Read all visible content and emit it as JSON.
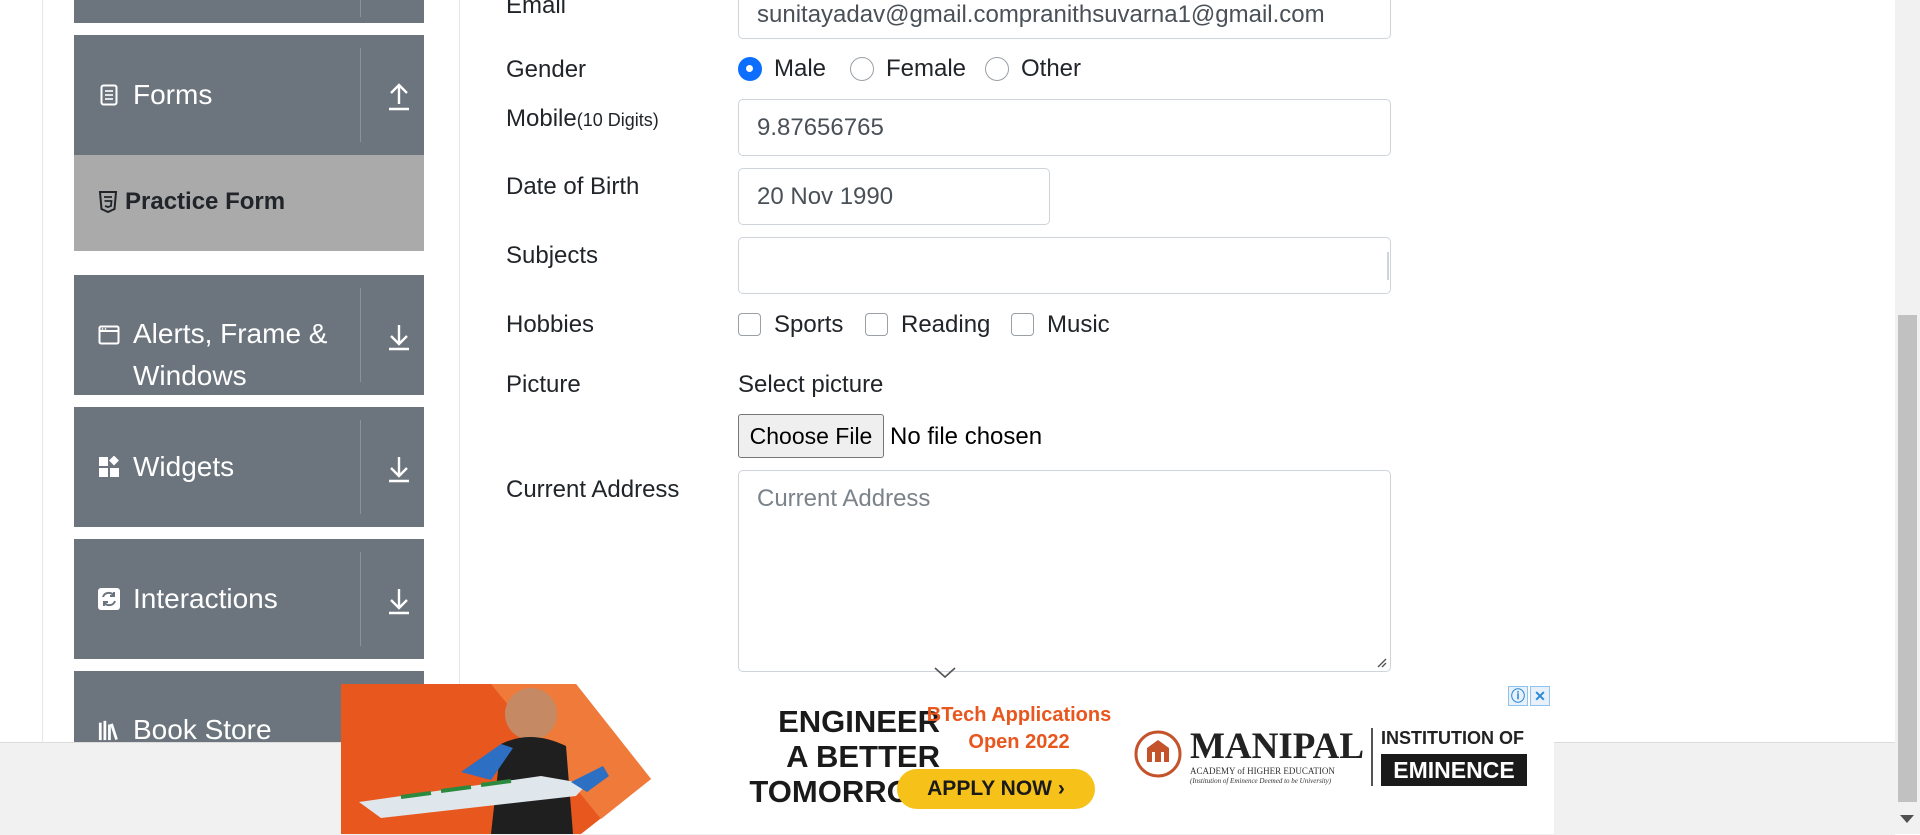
{
  "sidebar": {
    "forms": {
      "label": "Forms",
      "icon": "document-icon",
      "arrow": "collapse-arrow-up-icon"
    },
    "practice_form": {
      "label": "Practice Form",
      "icon": "html5-icon"
    },
    "alerts": {
      "label_line1": "Alerts, Frame &",
      "label_line2": "Windows",
      "icon": "window-icon",
      "arrow": "expand-arrow-down-icon"
    },
    "widgets": {
      "label": "Widgets",
      "icon": "widgets-icon",
      "arrow": "expand-arrow-down-icon"
    },
    "interactions": {
      "label": "Interactions",
      "icon": "interactions-icon",
      "arrow": "expand-arrow-down-icon"
    },
    "book_store": {
      "label": "Book Store",
      "icon": "books-icon"
    }
  },
  "form": {
    "email": {
      "label": "Email",
      "value": "sunitayadav@gmail.compranithsuvarna1@gmail.com"
    },
    "gender": {
      "label": "Gender",
      "options": [
        "Male",
        "Female",
        "Other"
      ],
      "selected": "Male"
    },
    "mobile": {
      "label": "Mobile",
      "hint": "(10 Digits)",
      "value": "9.87656765"
    },
    "dob": {
      "label": "Date of Birth",
      "value": "20 Nov 1990"
    },
    "subjects": {
      "label": "Subjects",
      "value": ""
    },
    "hobbies": {
      "label": "Hobbies",
      "options": [
        "Sports",
        "Reading",
        "Music"
      ]
    },
    "picture": {
      "label": "Picture",
      "select_text": "Select picture",
      "button": "Choose File",
      "status": "No file chosen"
    },
    "address": {
      "label": "Current Address",
      "placeholder": "Current Address"
    }
  },
  "ad": {
    "headline": [
      "ENGINEER",
      "A BETTER",
      "TOMORROW"
    ],
    "btech": [
      "BTech Applications",
      "Open 2022"
    ],
    "cta": "APPLY NOW ›",
    "brand": "MANIPAL",
    "academy": "ACADEMY of HIGHER EDUCATION",
    "academy_sub": "(Institution of Eminence Deemed to be University)",
    "institution": "INSTITUTION OF",
    "eminence": "EMINENCE",
    "info_icon": "ⓘ",
    "close_icon": "✕"
  },
  "colors": {
    "sidebar_bg": "#6c757d",
    "active_item_bg": "#aaaaaa",
    "accent": "#0d6efd",
    "ad_orange": "#e8571e",
    "ad_yellow": "#f6c21a"
  }
}
